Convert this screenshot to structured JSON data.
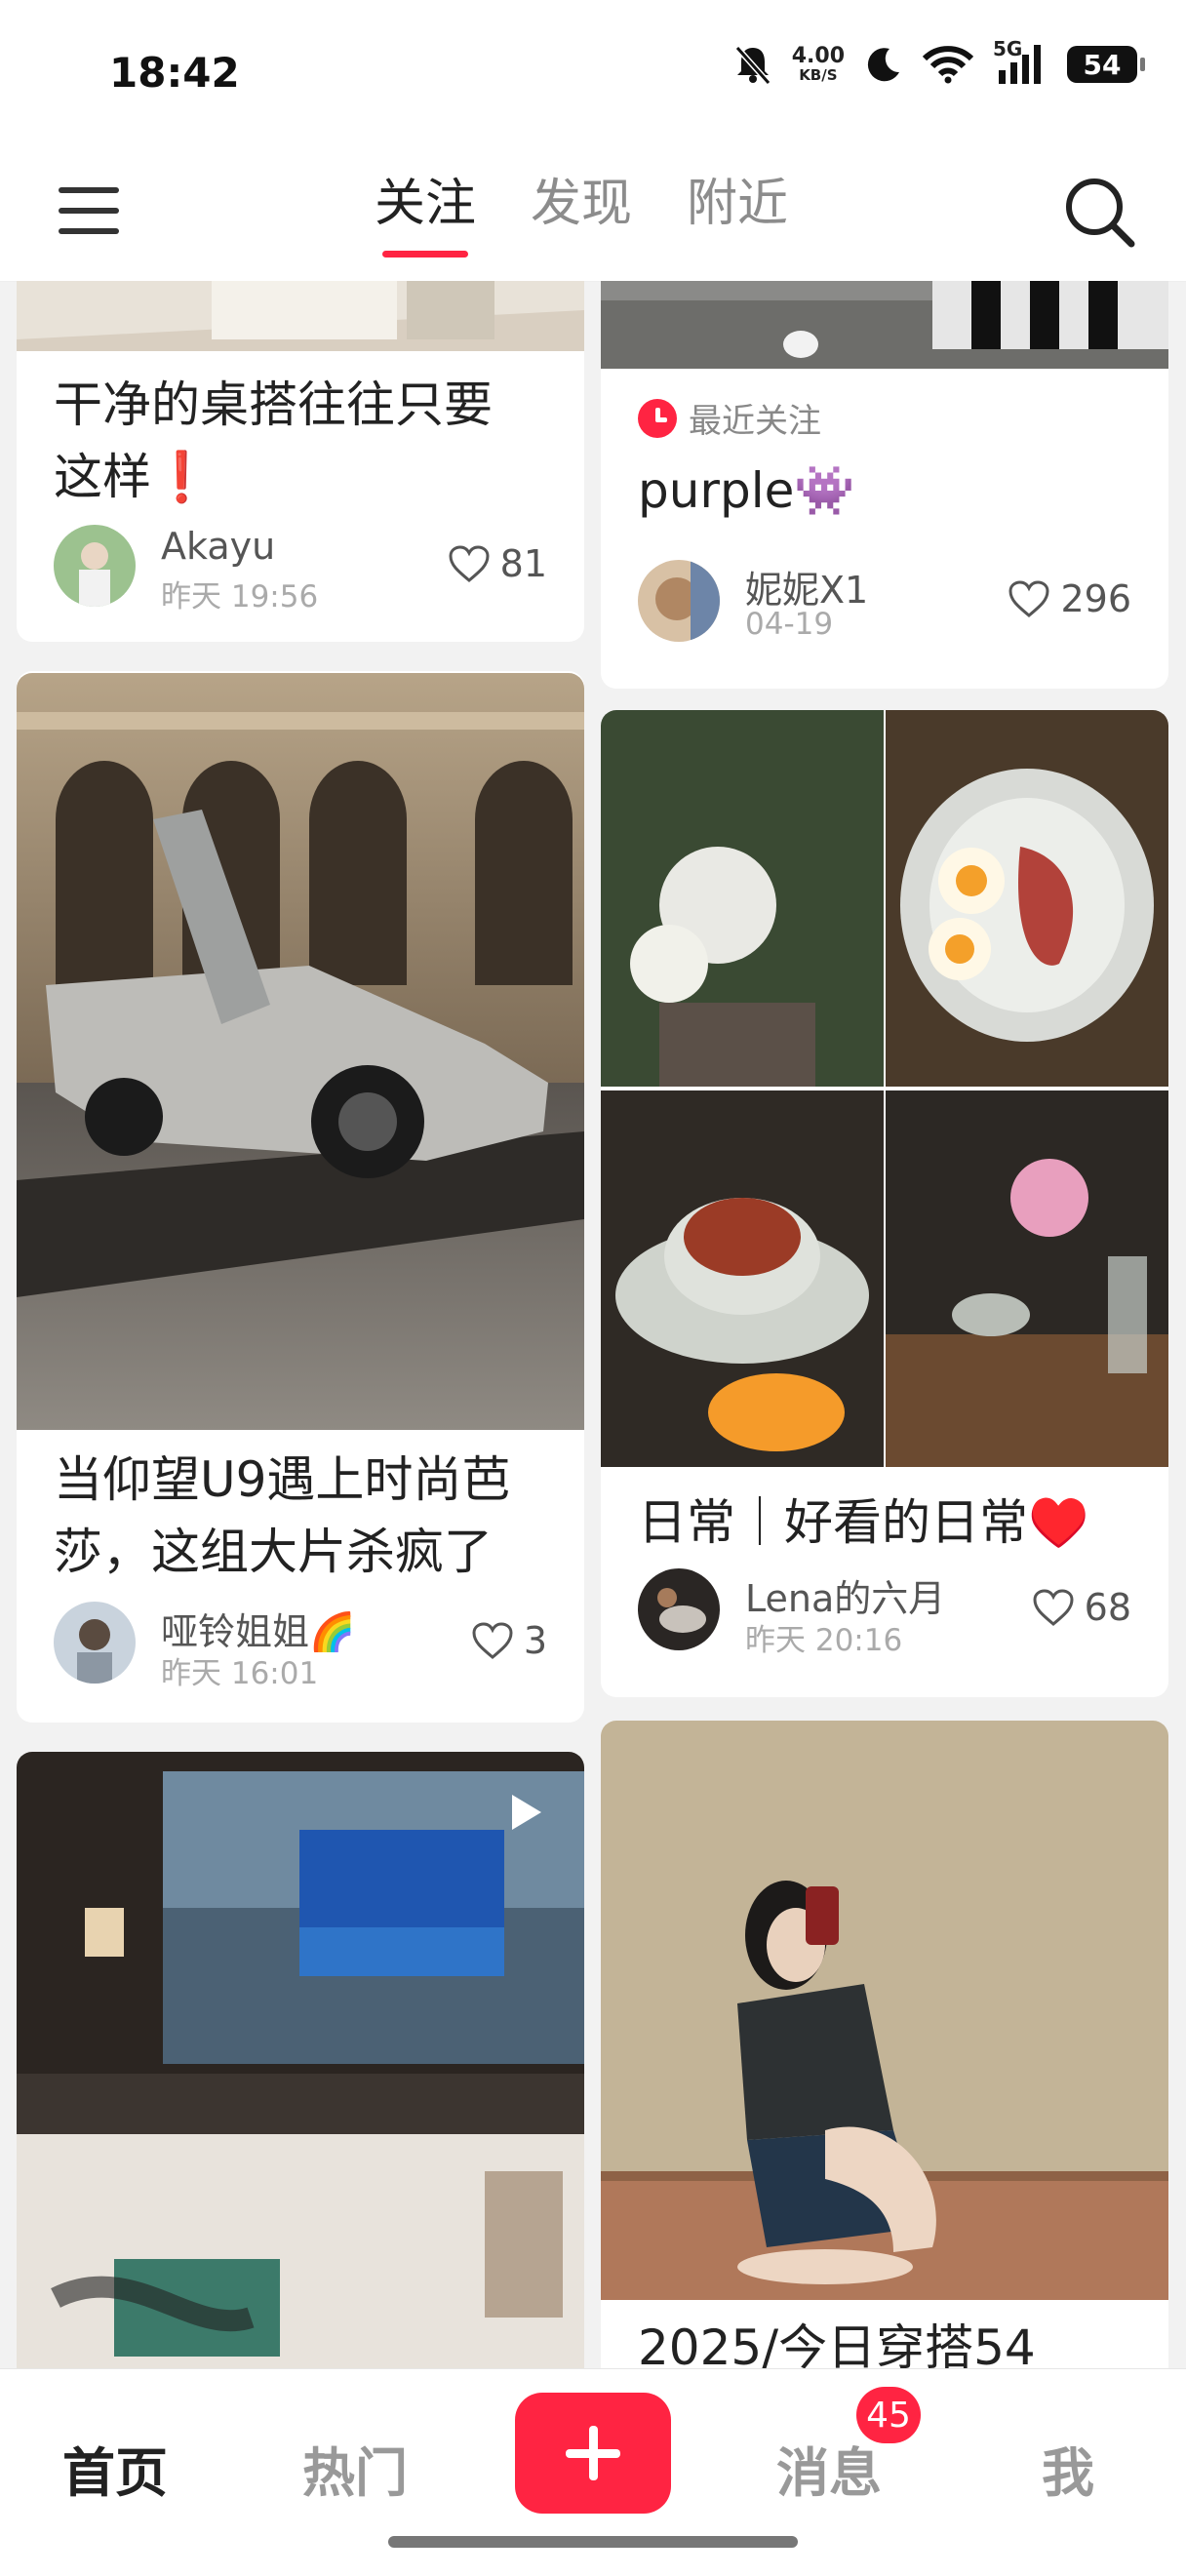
{
  "status_bar": {
    "time": "18:42",
    "net_speed": "4.00",
    "net_unit": "KB/S",
    "signal_label": "5G",
    "battery": "54",
    "icons": [
      "bell-muted-icon",
      "moon-icon",
      "wifi-icon",
      "signal-icon",
      "battery-icon"
    ]
  },
  "top_nav": {
    "tabs": [
      {
        "label": "关注",
        "active": true
      },
      {
        "label": "发现",
        "active": false
      },
      {
        "label": "附近",
        "active": false
      }
    ],
    "icons": [
      "menu-icon",
      "search-icon"
    ]
  },
  "feed": {
    "left": [
      {
        "title_line1": "干净的桌搭往往只要",
        "title_line2": "这样❗",
        "author": "Akayu",
        "date": "昨天 19:56",
        "likes": "81"
      },
      {
        "title_line1": "当仰望U9遇上时尚芭",
        "title_line2": "莎，这组大片杀疯了",
        "author": "哑铃姐姐🌈",
        "date": "昨天 16:01",
        "likes": "3"
      },
      {
        "type": "video"
      }
    ],
    "right": [
      {
        "recent_label": "最近关注",
        "title": "purple👾",
        "author": "妮妮X1",
        "date": "04-19",
        "likes": "296"
      },
      {
        "title": "日常｜好看的日常♥️",
        "author": "Lena的六月",
        "date": "昨天 20:16",
        "likes": "68"
      },
      {
        "title": "2025/今日穿搭54"
      }
    ]
  },
  "bottom_nav": {
    "items": [
      {
        "label": "首页",
        "active": true
      },
      {
        "label": "热门",
        "active": false
      },
      {
        "label": "消息",
        "active": false
      },
      {
        "label": "我",
        "active": false
      }
    ],
    "message_badge": "45"
  },
  "colors": {
    "accent": "#ff2442",
    "background": "#f2f2f2",
    "card": "#ffffff"
  }
}
